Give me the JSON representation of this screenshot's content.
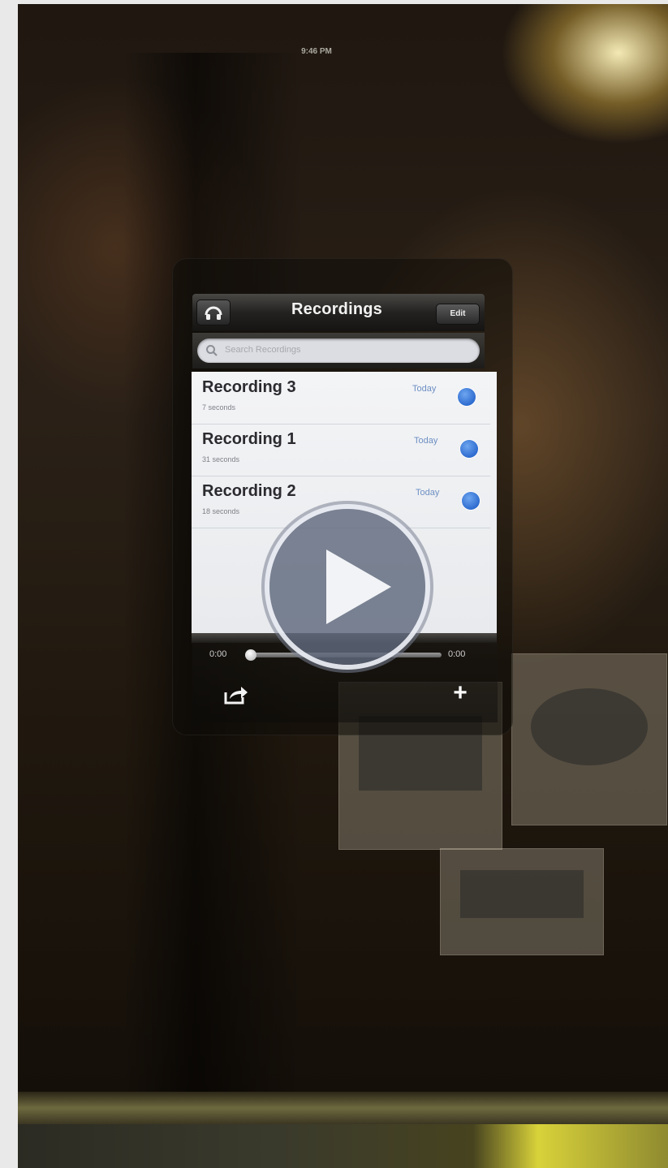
{
  "status_bar": {
    "time": "9:46 PM"
  },
  "nav": {
    "title": "Recordings",
    "edit_label": "Edit",
    "left_icon": "speaker-icon"
  },
  "search": {
    "placeholder": "Search Recordings"
  },
  "recordings": [
    {
      "title": "Recording 3",
      "duration": "7 seconds",
      "date": "Today"
    },
    {
      "title": "Recording 1",
      "duration": "31 seconds",
      "date": "Today"
    },
    {
      "title": "Recording 2",
      "duration": "18 seconds",
      "date": "Today"
    }
  ],
  "player": {
    "time_start": "0:00",
    "time_end": "0:00",
    "progress": 0
  },
  "toolbar": {
    "share_icon": "share-icon",
    "add_label": "+"
  },
  "overlay": {
    "icon": "play-icon"
  },
  "colors": {
    "accent": "#2e6cd0",
    "date_text": "#6d8fc4"
  }
}
